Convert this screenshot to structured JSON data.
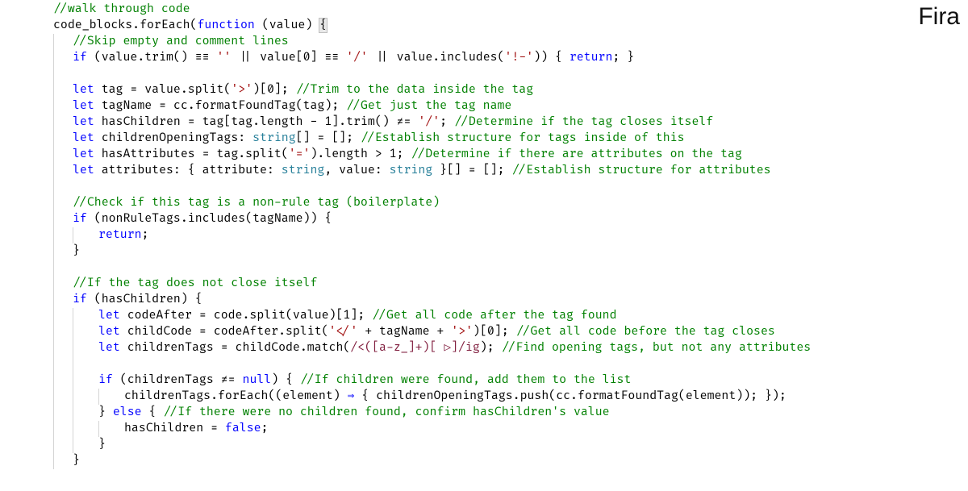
{
  "brand": "Fira",
  "colors": {
    "comment": "#008000",
    "keyword": "#0000FF",
    "string": "#A31515",
    "regex": "#811F3F",
    "type": "#267F99",
    "plain": "#000000"
  },
  "lines": [
    {
      "indent": 1,
      "spans": [
        {
          "t": "//walk through code",
          "c": "comment"
        }
      ]
    },
    {
      "indent": 1,
      "spans": [
        {
          "t": "code_blocks.forEach(",
          "c": "plain"
        },
        {
          "t": "function",
          "c": "fn"
        },
        {
          "t": " (value) ",
          "c": "plain"
        },
        {
          "t": "{",
          "c": "plain",
          "hl": true
        }
      ]
    },
    {
      "indent": 2,
      "spans": [
        {
          "t": "//Skip empty and comment lines",
          "c": "comment"
        }
      ]
    },
    {
      "indent": 2,
      "spans": [
        {
          "t": "if",
          "c": "kw"
        },
        {
          "t": " (value.trim() ",
          "c": "plain"
        },
        {
          "t": "===",
          "c": "plain",
          "lig": "≡≡"
        },
        {
          "t": " ",
          "c": "plain"
        },
        {
          "t": "''",
          "c": "str"
        },
        {
          "t": " ||  value[0] ",
          "c": "plain"
        },
        {
          "t": "===",
          "c": "plain",
          "lig": "≡≡"
        },
        {
          "t": " ",
          "c": "plain"
        },
        {
          "t": "'/'",
          "c": "str"
        },
        {
          "t": " ||  value.includes(",
          "c": "plain"
        },
        {
          "t": "'!-'",
          "c": "str"
        },
        {
          "t": ")) { ",
          "c": "plain"
        },
        {
          "t": "return",
          "c": "kw"
        },
        {
          "t": "; }",
          "c": "plain"
        }
      ]
    },
    {
      "indent": 2,
      "spans": [
        {
          "t": "",
          "c": "plain"
        }
      ]
    },
    {
      "indent": 2,
      "spans": [
        {
          "t": "let",
          "c": "kw"
        },
        {
          "t": " tag = value.split(",
          "c": "plain"
        },
        {
          "t": "'>'",
          "c": "str"
        },
        {
          "t": ")[0];",
          "c": "plain"
        },
        {
          "t": "                                   ",
          "c": "plain"
        },
        {
          "t": "//Trim to the data inside the tag",
          "c": "comment"
        }
      ]
    },
    {
      "indent": 2,
      "spans": [
        {
          "t": "let",
          "c": "kw"
        },
        {
          "t": " tagName = cc.formatFoundTag(tag);",
          "c": "plain"
        },
        {
          "t": "                              ",
          "c": "plain"
        },
        {
          "t": "//Get just the tag name",
          "c": "comment"
        }
      ]
    },
    {
      "indent": 2,
      "spans": [
        {
          "t": "let",
          "c": "kw"
        },
        {
          "t": " hasChildren = tag[tag.length - 1].trim() ",
          "c": "plain"
        },
        {
          "t": "!==",
          "c": "plain",
          "lig": "≠="
        },
        {
          "t": " ",
          "c": "plain"
        },
        {
          "t": "'/'",
          "c": "str"
        },
        {
          "t": ";",
          "c": "plain"
        },
        {
          "t": "            ",
          "c": "plain"
        },
        {
          "t": "//Determine if the tag closes itself",
          "c": "comment"
        }
      ]
    },
    {
      "indent": 2,
      "spans": [
        {
          "t": "let",
          "c": "kw"
        },
        {
          "t": " childrenOpeningTags: ",
          "c": "plain"
        },
        {
          "t": "string",
          "c": "type"
        },
        {
          "t": "[] = [];",
          "c": "plain"
        },
        {
          "t": "                          ",
          "c": "plain"
        },
        {
          "t": "//Establish structure for tags inside of this",
          "c": "comment"
        }
      ]
    },
    {
      "indent": 2,
      "spans": [
        {
          "t": "let",
          "c": "kw"
        },
        {
          "t": " hasAttributes = tag.split(",
          "c": "plain"
        },
        {
          "t": "'='",
          "c": "str"
        },
        {
          "t": ").length > 1;",
          "c": "plain"
        },
        {
          "t": "                  ",
          "c": "plain"
        },
        {
          "t": "//Determine if there are attributes on the tag",
          "c": "comment"
        }
      ]
    },
    {
      "indent": 2,
      "spans": [
        {
          "t": "let",
          "c": "kw"
        },
        {
          "t": " attributes: { attribute: ",
          "c": "plain"
        },
        {
          "t": "string",
          "c": "type"
        },
        {
          "t": ", value: ",
          "c": "plain"
        },
        {
          "t": "string",
          "c": "type"
        },
        {
          "t": " }[] = []; ",
          "c": "plain"
        },
        {
          "t": "//Establish structure for attributes",
          "c": "comment"
        }
      ]
    },
    {
      "indent": 2,
      "spans": [
        {
          "t": "",
          "c": "plain"
        }
      ]
    },
    {
      "indent": 2,
      "spans": [
        {
          "t": "//Check if this tag is a non-rule tag (boilerplate)",
          "c": "comment"
        }
      ]
    },
    {
      "indent": 2,
      "spans": [
        {
          "t": "if",
          "c": "kw"
        },
        {
          "t": " (nonRuleTags.includes(tagName)) {",
          "c": "plain"
        }
      ]
    },
    {
      "indent": 3,
      "spans": [
        {
          "t": "return",
          "c": "kw"
        },
        {
          "t": ";",
          "c": "plain"
        }
      ]
    },
    {
      "indent": 2,
      "spans": [
        {
          "t": "}",
          "c": "plain"
        }
      ]
    },
    {
      "indent": 2,
      "spans": [
        {
          "t": "",
          "c": "plain"
        }
      ]
    },
    {
      "indent": 2,
      "spans": [
        {
          "t": "//If the tag does not close itself",
          "c": "comment"
        }
      ]
    },
    {
      "indent": 2,
      "spans": [
        {
          "t": "if",
          "c": "kw"
        },
        {
          "t": " (hasChildren) {",
          "c": "plain"
        }
      ]
    },
    {
      "indent": 3,
      "spans": [
        {
          "t": "let",
          "c": "kw"
        },
        {
          "t": " codeAfter = code.split(value)[1];",
          "c": "plain"
        },
        {
          "t": "                        ",
          "c": "plain"
        },
        {
          "t": "//Get all code after the tag found",
          "c": "comment"
        }
      ]
    },
    {
      "indent": 3,
      "spans": [
        {
          "t": "let",
          "c": "kw"
        },
        {
          "t": " childCode = codeAfter.split(",
          "c": "plain"
        },
        {
          "t": "'</'",
          "c": "str"
        },
        {
          "t": " + tagName + ",
          "c": "plain"
        },
        {
          "t": "'>'",
          "c": "str"
        },
        {
          "t": ")[0];  ",
          "c": "plain"
        },
        {
          "t": "//Get all code before the tag closes",
          "c": "comment"
        }
      ]
    },
    {
      "indent": 3,
      "spans": [
        {
          "t": "let",
          "c": "kw"
        },
        {
          "t": " childrenTags = childCode.match(",
          "c": "plain"
        },
        {
          "t": "/<([a-z_]+)[ ▷]/ig",
          "c": "regex"
        },
        {
          "t": ");   ",
          "c": "plain"
        },
        {
          "t": "//Find opening tags, but not any attributes",
          "c": "comment"
        }
      ]
    },
    {
      "indent": 3,
      "spans": [
        {
          "t": "",
          "c": "plain"
        }
      ]
    },
    {
      "indent": 3,
      "spans": [
        {
          "t": "if",
          "c": "kw"
        },
        {
          "t": " (childrenTags ",
          "c": "plain"
        },
        {
          "t": "!==",
          "c": "plain",
          "lig": "≠="
        },
        {
          "t": " ",
          "c": "plain"
        },
        {
          "t": "null",
          "c": "lit"
        },
        {
          "t": ") { ",
          "c": "plain"
        },
        {
          "t": "//If children were found, add them to the list",
          "c": "comment"
        }
      ]
    },
    {
      "indent": 4,
      "spans": [
        {
          "t": "childrenTags.forEach((element) ",
          "c": "plain"
        },
        {
          "t": "=>",
          "c": "kw",
          "lig": "⇒"
        },
        {
          "t": " { childrenOpeningTags.push(cc.formatFoundTag(element)); });",
          "c": "plain"
        }
      ]
    },
    {
      "indent": 3,
      "spans": [
        {
          "t": "} ",
          "c": "plain"
        },
        {
          "t": "else",
          "c": "kw"
        },
        {
          "t": " { ",
          "c": "plain"
        },
        {
          "t": "//If there were no children found, confirm hasChildren's value",
          "c": "comment"
        }
      ]
    },
    {
      "indent": 4,
      "spans": [
        {
          "t": "hasChildren = ",
          "c": "plain"
        },
        {
          "t": "false",
          "c": "lit"
        },
        {
          "t": ";",
          "c": "plain"
        }
      ]
    },
    {
      "indent": 3,
      "spans": [
        {
          "t": "}",
          "c": "plain"
        }
      ]
    },
    {
      "indent": 2,
      "spans": [
        {
          "t": "}",
          "c": "plain"
        }
      ]
    }
  ]
}
